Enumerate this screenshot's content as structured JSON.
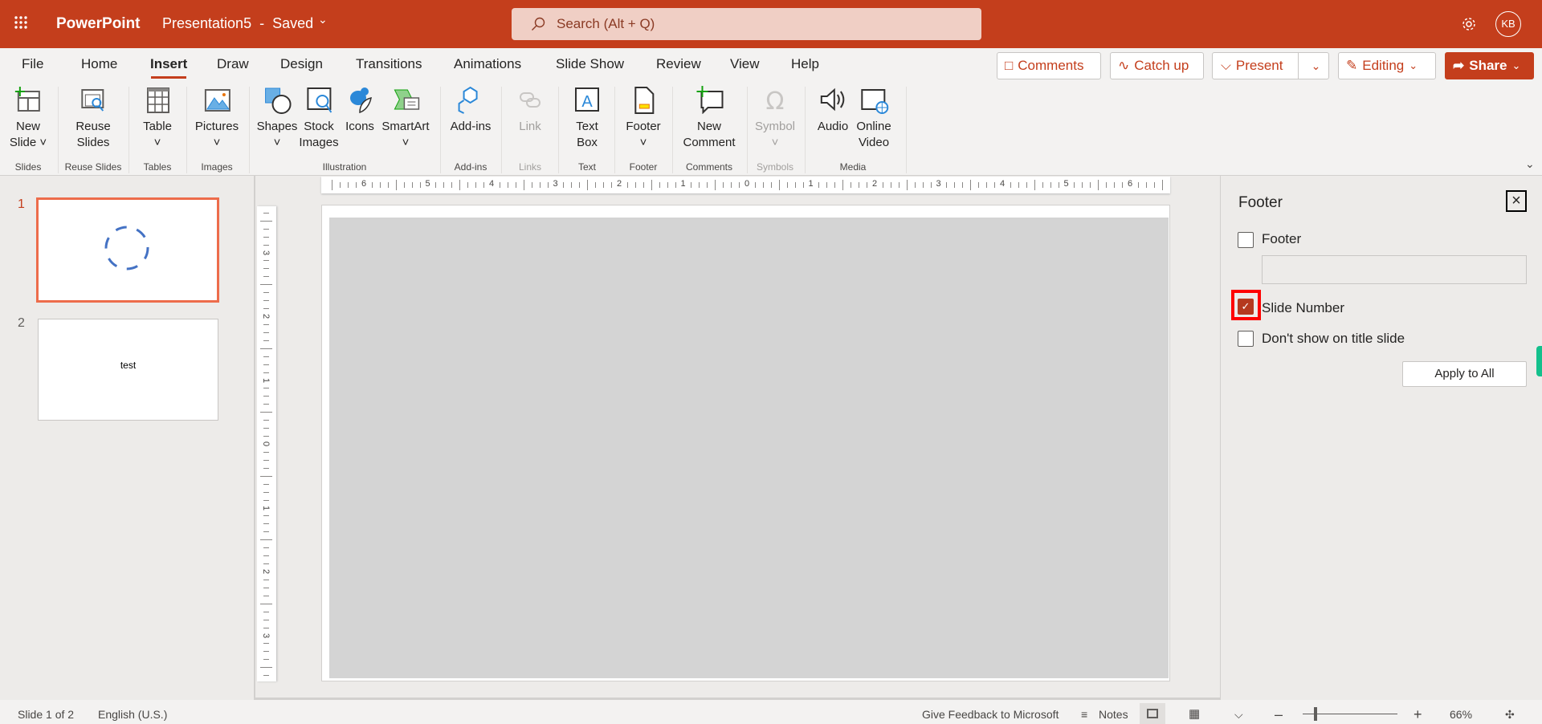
{
  "titlebar": {
    "app_name": "PowerPoint",
    "doc_title": "Presentation5  -  Saved",
    "search_placeholder": "Search (Alt + Q)",
    "avatar_initials": "KB",
    "brand_color": "#c43e1c"
  },
  "tabs": [
    {
      "label": "File"
    },
    {
      "label": "Home"
    },
    {
      "label": "Insert",
      "active": true
    },
    {
      "label": "Draw"
    },
    {
      "label": "Design"
    },
    {
      "label": "Transitions"
    },
    {
      "label": "Animations"
    },
    {
      "label": "Slide Show"
    },
    {
      "label": "Review"
    },
    {
      "label": "View"
    },
    {
      "label": "Help"
    }
  ],
  "actions": {
    "comments": "Comments",
    "catch_up": "Catch up",
    "present": "Present",
    "editing": "Editing",
    "share": "Share"
  },
  "ribbon": {
    "buttons": [
      {
        "l1": "New",
        "l2": "Slide ˅",
        "icon": "new-slide-icon"
      },
      {
        "l1": "Reuse",
        "l2": "Slides",
        "icon": "reuse-slides-icon"
      },
      {
        "l1": "Table",
        "l2": "˅",
        "icon": "table-icon"
      },
      {
        "l1": "Pictures",
        "l2": "˅",
        "icon": "pictures-icon"
      },
      {
        "l1": "Shapes",
        "l2": "˅",
        "icon": "shapes-icon"
      },
      {
        "l1": "Stock",
        "l2": "Images",
        "icon": "stock-images-icon"
      },
      {
        "l1": "Icons",
        "l2": "",
        "icon": "icons-icon"
      },
      {
        "l1": "SmartArt",
        "l2": "˅",
        "icon": "smartart-icon"
      },
      {
        "l1": "Add-ins",
        "l2": "",
        "icon": "add-ins-icon"
      },
      {
        "l1": "Link",
        "l2": "",
        "icon": "link-icon",
        "disabled": true
      },
      {
        "l1": "Text",
        "l2": "Box",
        "icon": "text-box-icon"
      },
      {
        "l1": "Footer",
        "l2": "˅",
        "icon": "footer-icon"
      },
      {
        "l1": "New",
        "l2": "Comment",
        "icon": "new-comment-icon"
      },
      {
        "l1": "Symbol",
        "l2": "˅",
        "icon": "symbol-icon",
        "disabled": true
      },
      {
        "l1": "Audio",
        "l2": "",
        "icon": "audio-icon"
      },
      {
        "l1": "Online",
        "l2": "Video",
        "icon": "online-video-icon"
      }
    ],
    "groups": [
      "Slides",
      "Reuse Slides",
      "Tables",
      "Images",
      "Illustration",
      "Add-ins",
      "Links",
      "Text",
      "Footer",
      "Comments",
      "Symbols",
      "Media"
    ]
  },
  "slides": [
    {
      "number": "1",
      "selected": true,
      "text": ""
    },
    {
      "number": "2",
      "text": "test"
    }
  ],
  "ruler": {
    "horizontal": [
      "6",
      "5",
      "4",
      "3",
      "2",
      "1",
      "0",
      "1",
      "2",
      "3",
      "4",
      "5",
      "6"
    ],
    "vertical": [
      "3",
      "2",
      "1",
      "0",
      "1",
      "2",
      "3"
    ]
  },
  "footer_pane": {
    "title": "Footer",
    "footer_label": "Footer",
    "footer_checked": false,
    "footer_value": "",
    "slide_number_label": "Slide Number",
    "slide_number_checked": true,
    "dont_show_label": "Don't show on title slide",
    "dont_show_checked": false,
    "apply_all": "Apply to All"
  },
  "statusbar": {
    "slide_info": "Slide 1 of 2",
    "language": "English (U.S.)",
    "feedback": "Give Feedback to Microsoft",
    "notes": "Notes",
    "zoom": "66%",
    "zoom_level_percent": 66
  }
}
